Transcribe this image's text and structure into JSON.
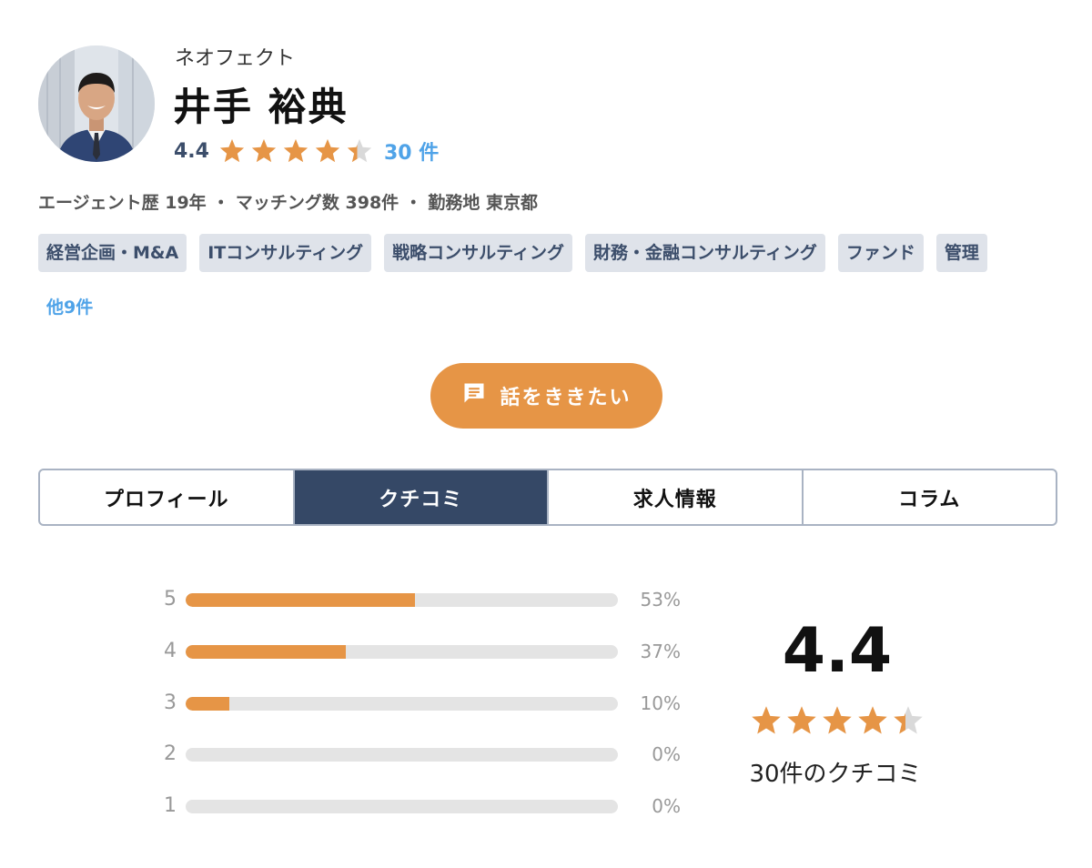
{
  "agent": {
    "company": "ネオフェクト",
    "name": "井手 裕典",
    "rating": "4.4",
    "rating_value": 4.4,
    "review_count": "30 件",
    "meta": "エージェント歴 19年 ・ マッチング数 398件 ・ 勤務地 東京都"
  },
  "tags": [
    "経営企画・M&A",
    "ITコンサルティング",
    "戦略コンサルティング",
    "財務・金融コンサルティング",
    "ファンド",
    "管理"
  ],
  "more_tags": "他9件",
  "cta": {
    "label": "話をききたい",
    "icon": "chat-icon"
  },
  "tabs": [
    {
      "label": "プロフィール",
      "active": false
    },
    {
      "label": "クチコミ",
      "active": true
    },
    {
      "label": "求人情報",
      "active": false
    },
    {
      "label": "コラム",
      "active": false
    }
  ],
  "distribution": [
    {
      "star": "5",
      "percent": 53,
      "label": "53%"
    },
    {
      "star": "4",
      "percent": 37,
      "label": "37%"
    },
    {
      "star": "3",
      "percent": 10,
      "label": "10%"
    },
    {
      "star": "2",
      "percent": 0,
      "label": "0%"
    },
    {
      "star": "1",
      "percent": 0,
      "label": "0%"
    }
  ],
  "summary": {
    "score": "4.4",
    "stars": 4.4,
    "review_text": "30件のクチコミ"
  },
  "colors": {
    "accent": "#e69546",
    "navy": "#354866",
    "link": "#4fa3e8",
    "star_empty": "#d9d9d9"
  }
}
